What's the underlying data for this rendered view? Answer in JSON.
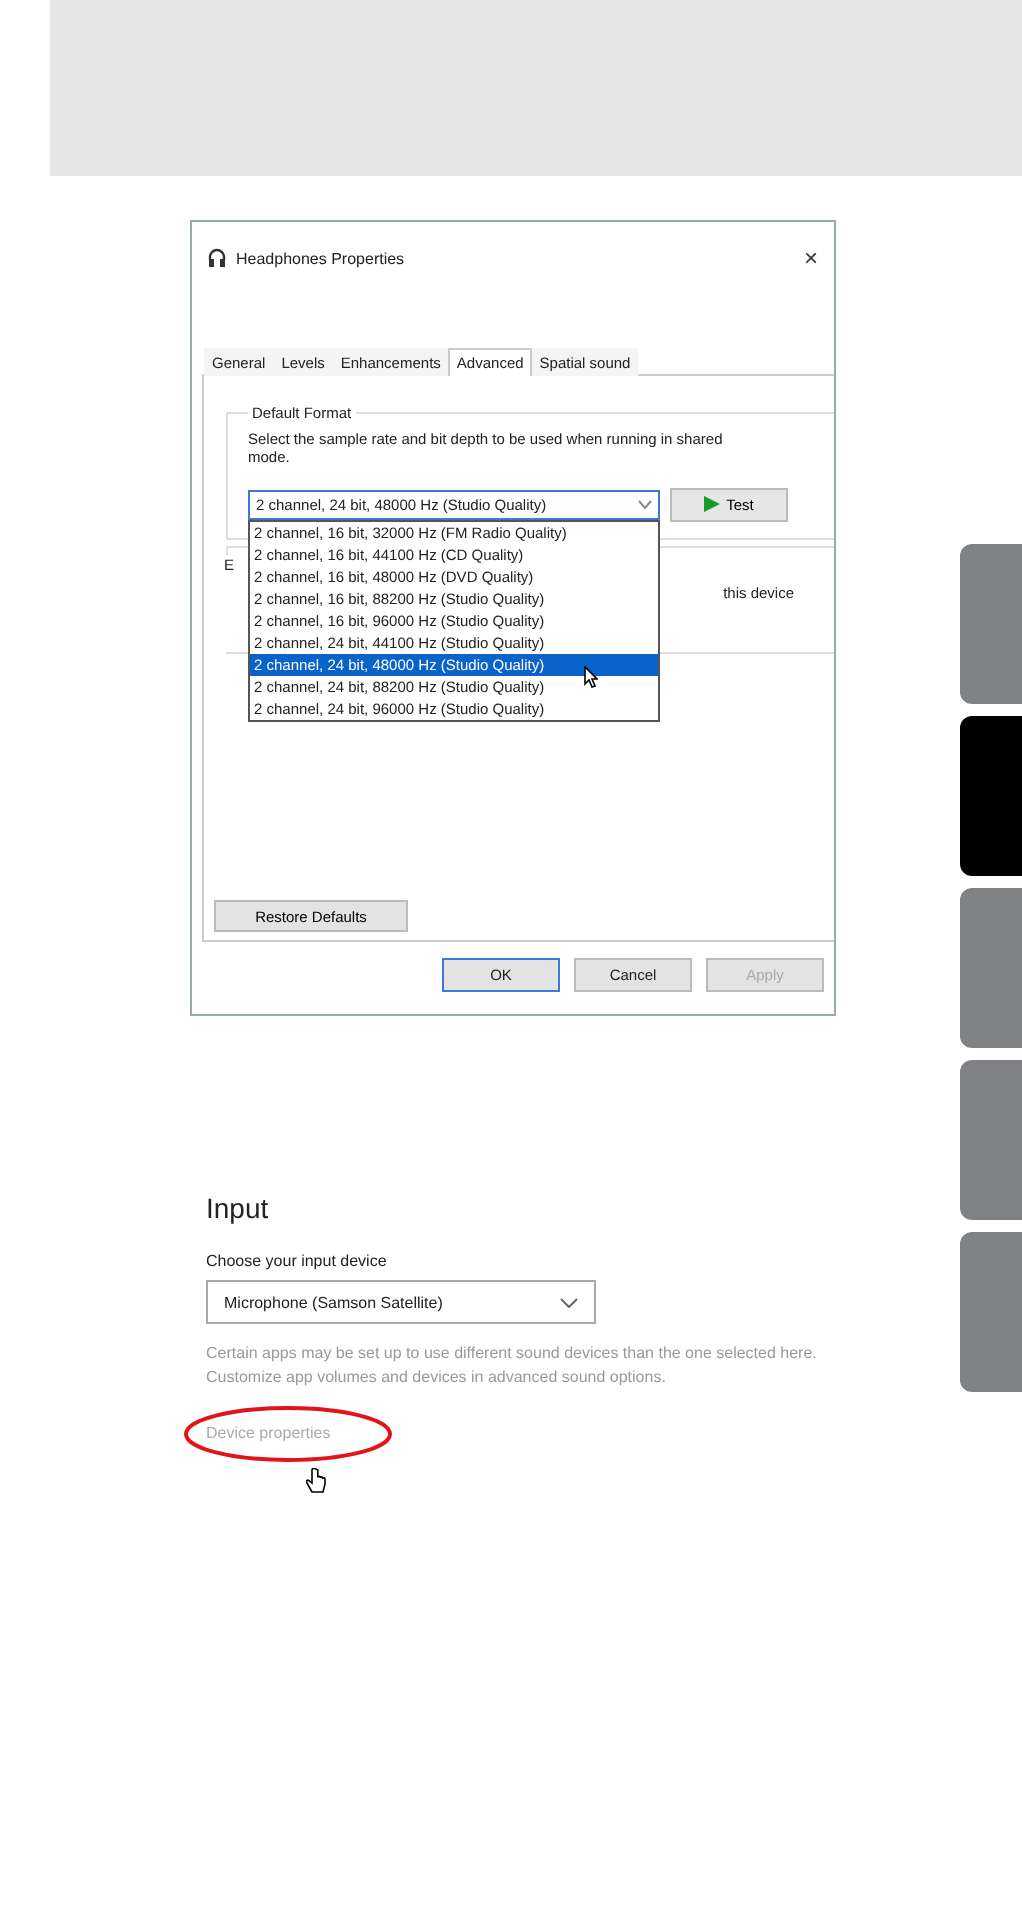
{
  "dialog": {
    "title": "Headphones Properties",
    "close": "×",
    "tabs": [
      {
        "label": "General",
        "selected": false
      },
      {
        "label": "Levels",
        "selected": false
      },
      {
        "label": "Enhancements",
        "selected": false
      },
      {
        "label": "Advanced",
        "selected": true
      },
      {
        "label": "Spatial sound",
        "selected": false
      }
    ],
    "group_title": "Default Format",
    "description": "Select the sample rate and bit depth to be used when running in shared mode.",
    "format_value": "2 channel, 24 bit, 48000 Hz (Studio Quality)",
    "test_button": "Test",
    "format_options": [
      {
        "label": "2 channel, 16 bit, 32000 Hz (FM Radio Quality)",
        "selected": false
      },
      {
        "label": "2 channel, 16 bit, 44100 Hz (CD Quality)",
        "selected": false
      },
      {
        "label": "2 channel, 16 bit, 48000 Hz (DVD Quality)",
        "selected": false
      },
      {
        "label": "2 channel, 16 bit, 88200 Hz (Studio Quality)",
        "selected": false
      },
      {
        "label": "2 channel, 16 bit, 96000 Hz (Studio Quality)",
        "selected": false
      },
      {
        "label": "2 channel, 24 bit, 44100 Hz (Studio Quality)",
        "selected": false
      },
      {
        "label": "2 channel, 24 bit, 48000 Hz (Studio Quality)",
        "selected": true
      },
      {
        "label": "2 channel, 24 bit, 88200 Hz (Studio Quality)",
        "selected": false
      },
      {
        "label": "2 channel, 24 bit, 96000 Hz (Studio Quality)",
        "selected": false
      }
    ],
    "second_group_fragment": "E",
    "second_group_text": "this device",
    "restore_button": "Restore Defaults",
    "buttons": [
      {
        "label": "OK",
        "disabled": false
      },
      {
        "label": "Cancel",
        "disabled": false
      },
      {
        "label": "Apply",
        "disabled": true
      }
    ]
  },
  "input_panel": {
    "heading": "Input",
    "label": "Choose your input device",
    "device": "Microphone (Samson Satellite)",
    "help": "Certain apps may be set up to use different sound devices than the one selected here. Customize app volumes and devices in advanced sound options.",
    "link": "Device properties"
  },
  "side_tabs": [
    {
      "selected": false
    },
    {
      "selected": true
    },
    {
      "selected": false
    },
    {
      "selected": false
    },
    {
      "selected": false
    }
  ]
}
